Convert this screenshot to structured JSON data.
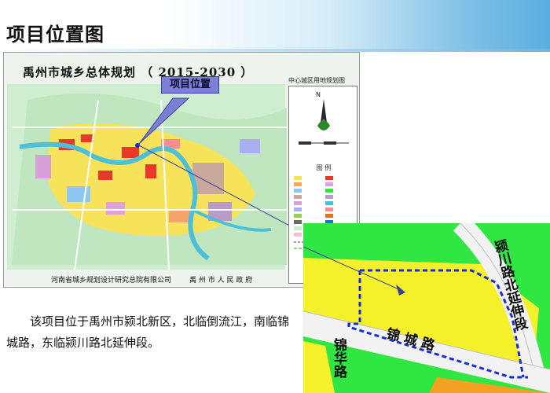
{
  "slide": {
    "title": "项目位置图"
  },
  "plan_map": {
    "title": "禹州市城乡总体规划  （ 2015-2030 ）",
    "subtitle": "中心城区用地规划图",
    "callout": "项目位置",
    "north_label": "N",
    "legend_title": "图  例",
    "footer_left": "河南省城乡规划设计研究总院有限公司",
    "footer_right": "禹 州 市 人 民 政 府"
  },
  "description": "该项目位于禹州市颍北新区，北临倒流江，南临锦城路，东临颍川路北延伸段。",
  "zoom_map": {
    "road_east": "颍川路北延伸段",
    "road_south": "锦 城 路",
    "road_west": "锦华路"
  },
  "colors": {
    "residential": "#f4f02a",
    "green_space": "#30e642",
    "road": "#f2f2f2",
    "boundary": "#1a2bd6",
    "callout": "#7c7fd6",
    "commercial": "#e8382a"
  }
}
